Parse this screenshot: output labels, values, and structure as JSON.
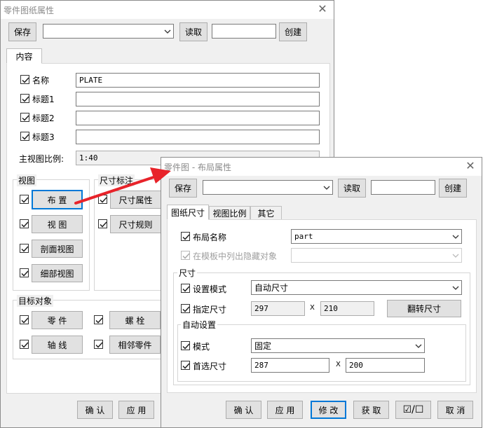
{
  "dialog1": {
    "title": "零件图纸属性",
    "save": "保存",
    "read": "读取",
    "create": "创建",
    "tab": "内容",
    "rows": [
      {
        "label": "名称",
        "value": "PLATE"
      },
      {
        "label": "标题1",
        "value": ""
      },
      {
        "label": "标题2",
        "value": ""
      },
      {
        "label": "标题3",
        "value": ""
      }
    ],
    "scale_label": "主视图比例:",
    "scale_value": "1:40",
    "views_group": "视图",
    "views": [
      "布 置",
      "视 图",
      "剖面视图",
      "细部视图"
    ],
    "dim_group": "尺寸标注",
    "dims": [
      "尺寸属性",
      "尺寸规则"
    ],
    "target_group": "目标对象",
    "targets": [
      "零 件",
      "螺 栓",
      "轴 线",
      "相邻零件"
    ],
    "ok": "确 认",
    "apply": "应 用"
  },
  "dialog2": {
    "title": "零件图 - 布局属性",
    "save": "保存",
    "read": "读取",
    "create": "创建",
    "tabs": [
      "图纸尺寸",
      "视图比例",
      "其它"
    ],
    "layout_name_label": "布局名称",
    "layout_name_value": "part",
    "show_hidden_label": "在模板中列出隐藏对象",
    "size_group": "尺寸",
    "mode_label": "设置模式",
    "mode_value": "自动尺寸",
    "given_label": "指定尺寸",
    "given_w": "297",
    "given_x": "X",
    "given_h": "210",
    "flip": "翻转尺寸",
    "auto_group": "自动设置",
    "auto_mode_label": "模式",
    "auto_mode_value": "固定",
    "pref_label": "首选尺寸",
    "pref_w": "287",
    "pref_x": "X",
    "pref_h": "200",
    "buttons": [
      "确 认",
      "应 用",
      "修 改",
      "获 取",
      "☑/☐",
      "取 消"
    ]
  },
  "colors": {
    "arrow": "#e8232a",
    "focus": "#0078d7"
  }
}
